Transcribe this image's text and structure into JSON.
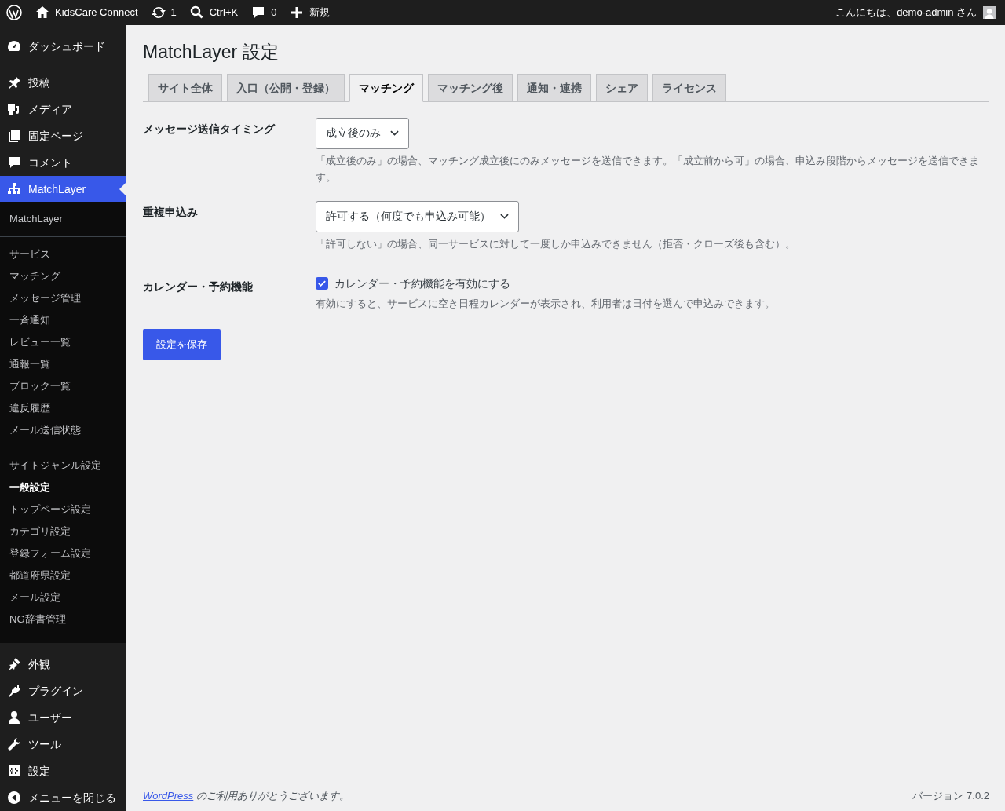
{
  "admin_bar": {
    "site_name": "KidsCare Connect",
    "updates": "1",
    "search_shortcut": "Ctrl+K",
    "comments": "0",
    "new": "新規",
    "greeting": "こんにちは、demo-admin さん"
  },
  "sidebar": {
    "top_items": [
      {
        "label": "ダッシュボード",
        "selected": false
      },
      {
        "label": "投稿",
        "selected": false
      },
      {
        "label": "メディア",
        "selected": false
      },
      {
        "label": "固定ページ",
        "selected": false
      },
      {
        "label": "コメント",
        "selected": false
      },
      {
        "label": "MatchLayer",
        "selected": true
      }
    ],
    "submenu_groups": [
      [
        {
          "label": "MatchLayer",
          "selected": false
        }
      ],
      [
        {
          "label": "サービス",
          "selected": false
        },
        {
          "label": "マッチング",
          "selected": false
        },
        {
          "label": "メッセージ管理",
          "selected": false
        },
        {
          "label": "一斉通知",
          "selected": false
        },
        {
          "label": "レビュー一覧",
          "selected": false
        },
        {
          "label": "通報一覧",
          "selected": false
        },
        {
          "label": "ブロック一覧",
          "selected": false
        },
        {
          "label": "違反履歴",
          "selected": false
        },
        {
          "label": "メール送信状態",
          "selected": false
        }
      ],
      [
        {
          "label": "サイトジャンル設定",
          "selected": false
        },
        {
          "label": "一般設定",
          "selected": true
        },
        {
          "label": "トップページ設定",
          "selected": false
        },
        {
          "label": "カテゴリ設定",
          "selected": false
        },
        {
          "label": "登録フォーム設定",
          "selected": false
        },
        {
          "label": "都道府県設定",
          "selected": false
        },
        {
          "label": "メール設定",
          "selected": false
        },
        {
          "label": "NG辞書管理",
          "selected": false
        }
      ]
    ],
    "bottom_items": [
      {
        "label": "外観",
        "selected": false
      },
      {
        "label": "プラグイン",
        "selected": false
      },
      {
        "label": "ユーザー",
        "selected": false
      },
      {
        "label": "ツール",
        "selected": false
      },
      {
        "label": "設定",
        "selected": false
      },
      {
        "label": "メニューを閉じる",
        "selected": false
      }
    ]
  },
  "page": {
    "title": "MatchLayer 設定",
    "tabs": [
      {
        "label": "サイト全体",
        "selected": false
      },
      {
        "label": "入口（公開・登録）",
        "selected": false
      },
      {
        "label": "マッチング",
        "selected": true
      },
      {
        "label": "マッチング後",
        "selected": false
      },
      {
        "label": "通知・連携",
        "selected": false
      },
      {
        "label": "シェア",
        "selected": false
      },
      {
        "label": "ライセンス",
        "selected": false
      }
    ],
    "fields": [
      {
        "kind": "select",
        "label": "メッセージ送信タイミング",
        "value": "成立後のみ",
        "description": "「成立後のみ」の場合、マッチング成立後にのみメッセージを送信できます。「成立前から可」の場合、申込み段階からメッセージを送信できます。"
      },
      {
        "kind": "select",
        "label": "重複申込み",
        "value": "許可する（何度でも申込み可能）",
        "description": "「許可しない」の場合、同一サービスに対して一度しか申込みできません（拒否・クローズ後も含む）。"
      },
      {
        "kind": "checkbox",
        "label": "カレンダー・予約機能",
        "value": "カレンダー・予約機能を有効にする",
        "checked": true,
        "description": "有効にすると、サービスに空き日程カレンダーが表示され、利用者は日付を選んで申込みできます。"
      }
    ],
    "save_button": "設定を保存"
  },
  "footer": {
    "link": "WordPress",
    "thanks": "のご利用ありがとうございます。",
    "version": "バージョン 7.0.2"
  }
}
